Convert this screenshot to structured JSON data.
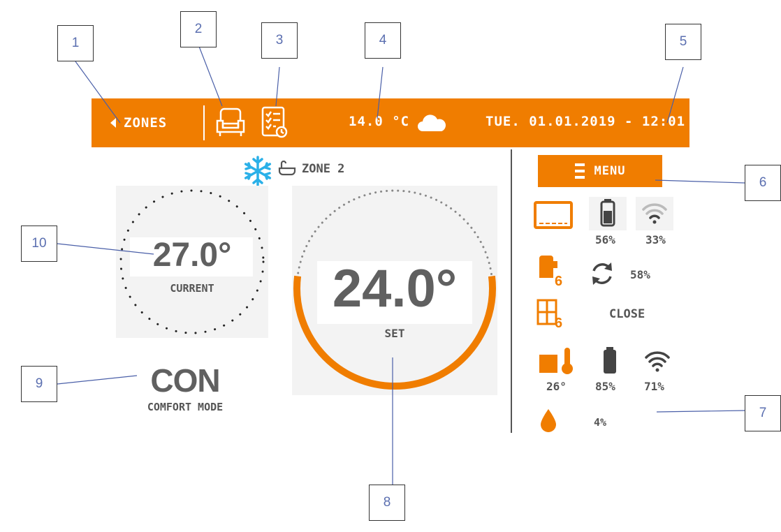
{
  "topbar": {
    "back_label": "ZONES",
    "outdoor_temp": "14.0 °C",
    "datetime": "TUE. 01.01.2019 - 12:01"
  },
  "zone": {
    "name": "ZONE 2"
  },
  "current": {
    "value": "27.0°",
    "label": "CURRENT"
  },
  "set": {
    "value": "24.0°",
    "label": "SET",
    "level": 0.5
  },
  "mode": {
    "short": "CON",
    "label": "COMFORT MODE"
  },
  "menu": {
    "label": "MENU"
  },
  "status": {
    "panel_battery": "56%",
    "panel_signal": "33%",
    "valve_count": "6",
    "valve_opening": "58%",
    "window_count": "6",
    "window_state": "CLOSE",
    "sensor_temp": "26°",
    "sensor_battery": "85%",
    "sensor_signal": "71%",
    "humidity": "4%"
  },
  "callouts": [
    "1",
    "2",
    "3",
    "4",
    "5",
    "6",
    "7",
    "8",
    "9",
    "10"
  ],
  "colors": {
    "accent": "#f07d00",
    "snow": "#2ab0e8",
    "text": "#606060"
  }
}
